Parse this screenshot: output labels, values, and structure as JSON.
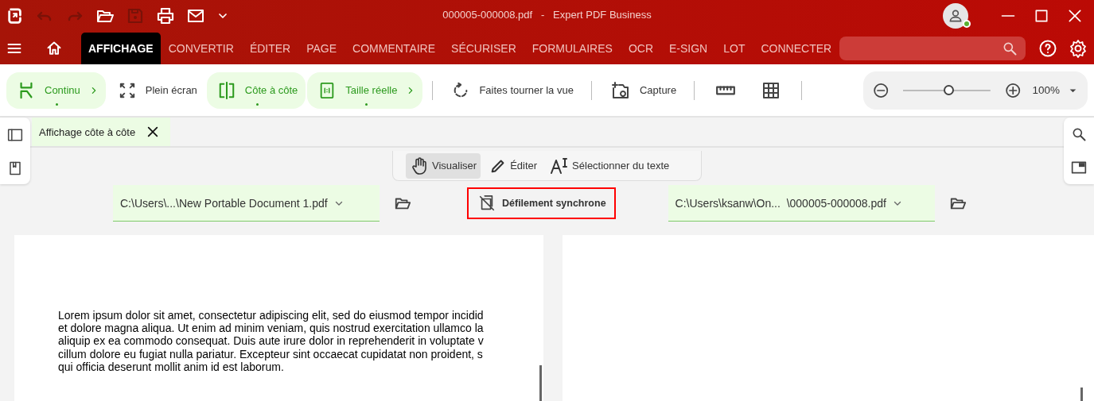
{
  "title_bar": {
    "title": "000005-000008.pdf   -   Expert PDF Business",
    "user_online": true
  },
  "menu_tabs": [
    {
      "label": "AFFICHAGE",
      "selected": true
    },
    {
      "label": "CONVERTIR",
      "selected": false
    },
    {
      "label": "ÉDITER",
      "selected": false
    },
    {
      "label": "PAGE",
      "selected": false
    },
    {
      "label": "COMMENTAIRE",
      "selected": false
    },
    {
      "label": "SÉCURISER",
      "selected": false
    },
    {
      "label": "FORMULAIRES",
      "selected": false
    },
    {
      "label": "OCR",
      "selected": false
    },
    {
      "label": "E-SIGN",
      "selected": false
    },
    {
      "label": "LOT",
      "selected": false
    },
    {
      "label": "CONNECTER",
      "selected": false
    }
  ],
  "ribbon": [
    {
      "kind": "button",
      "label": "Continu",
      "active": true,
      "submenu": true
    },
    {
      "kind": "button",
      "label": "Plein écran",
      "active": false,
      "submenu": false
    },
    {
      "kind": "button",
      "label": "Côte à côte",
      "active": true,
      "submenu": false
    },
    {
      "kind": "button",
      "label": "Taille réelle",
      "active": true,
      "submenu": true
    },
    {
      "kind": "separator"
    },
    {
      "kind": "button",
      "label": "Faites tourner la vue",
      "active": false,
      "submenu": false
    },
    {
      "kind": "separator"
    },
    {
      "kind": "button",
      "label": "Capture",
      "active": false,
      "submenu": false
    },
    {
      "kind": "separator"
    },
    {
      "kind": "icon"
    },
    {
      "kind": "icon"
    },
    {
      "kind": "separator"
    }
  ],
  "zoom": {
    "level": 0.52,
    "value": "100%"
  },
  "doc_tab": {
    "label": "Affichage côte à côte"
  },
  "modes": [
    {
      "label": "Visualiser",
      "selected": true
    },
    {
      "label": "Éditer",
      "selected": false
    },
    {
      "label": "Sélectionner du texte",
      "selected": false
    }
  ],
  "compare_bar": {
    "left_file": "C:\\Users\\...\\New Portable Document 1.pdf",
    "sync": {
      "label": "Défilement synchrone",
      "highlighted": true
    },
    "right_file": "C:\\Users\\ksanw\\On...  \\000005-000008.pdf"
  },
  "left_page": {
    "lines": [
      "Lorem ipsum dolor sit amet, consectetur adipiscing elit, sed do eiusmod tempor incidid",
      "et dolore magna aliqua. Ut enim ad minim veniam, quis nostrud exercitation ullamco la",
      "aliquip ex ea commodo consequat. Duis aute irure dolor in reprehenderit in voluptate v",
      "cillum dolore eu fugiat nulla pariatur. Excepteur sint occaecat cupidatat non proident, s",
      "qui officia deserunt mollit anim id est laborum."
    ]
  }
}
